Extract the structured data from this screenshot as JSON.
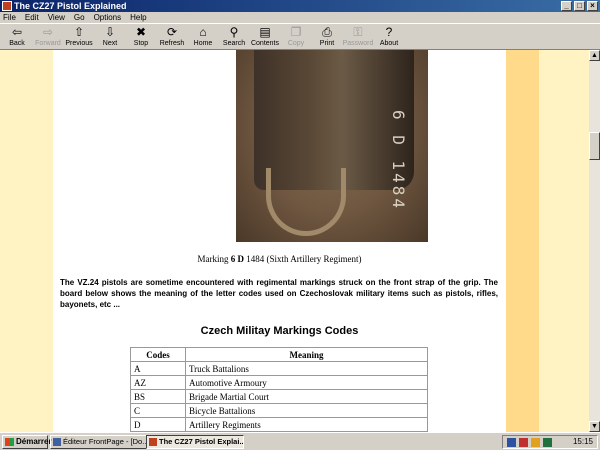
{
  "window": {
    "title": "The CZ27 Pistol Explained"
  },
  "menu": [
    "File",
    "Edit",
    "View",
    "Go",
    "Options",
    "Help"
  ],
  "toolbar": [
    {
      "label": "Back",
      "icon": "arrow-left-icon",
      "glyph": "⇦",
      "enabled": true
    },
    {
      "label": "Forward",
      "icon": "arrow-right-icon",
      "glyph": "⇨",
      "enabled": false
    },
    {
      "label": "Previous",
      "icon": "arrow-up-icon",
      "glyph": "⇧",
      "enabled": true
    },
    {
      "label": "Next",
      "icon": "arrow-down-icon",
      "glyph": "⇩",
      "enabled": true
    },
    {
      "label": "Stop",
      "icon": "stop-icon",
      "glyph": "✖",
      "enabled": true
    },
    {
      "label": "Refresh",
      "icon": "refresh-icon",
      "glyph": "⟳",
      "enabled": true
    },
    {
      "label": "Home",
      "icon": "home-icon",
      "glyph": "⌂",
      "enabled": true
    },
    {
      "label": "Search",
      "icon": "search-icon",
      "glyph": "⚲",
      "enabled": true
    },
    {
      "label": "Contents",
      "icon": "contents-icon",
      "glyph": "▤",
      "enabled": true
    },
    {
      "label": "Copy",
      "icon": "copy-icon",
      "glyph": "❐",
      "enabled": false
    },
    {
      "label": "Print",
      "icon": "print-icon",
      "glyph": "⎙",
      "enabled": true
    },
    {
      "label": "Password",
      "icon": "password-icon",
      "glyph": "⚿",
      "enabled": false
    },
    {
      "label": "About",
      "icon": "about-icon",
      "glyph": "?",
      "enabled": true
    }
  ],
  "page": {
    "photo_marking": "6 D 1484",
    "caption_prefix": "Marking ",
    "caption_bold": "6 D",
    "caption_suffix": " 1484 (Sixth Artillery Regiment)",
    "paragraph": "The VZ.24 pistols are sometime encountered with regimental markings struck on the front strap of the grip. The board below shows the meaning of the letter codes used on Czechoslovak military items such as pistols, rifles, bayonets, etc ...",
    "heading": "Czech Militay Markings Codes",
    "table": {
      "headers": [
        "Codes",
        "Meaning"
      ],
      "rows": [
        [
          "A",
          "Truck Battalions"
        ],
        [
          "AZ",
          "Automotive Armoury"
        ],
        [
          "BS",
          "Brigade Martial Court"
        ],
        [
          "C",
          "Bicycle Battalions"
        ],
        [
          "D",
          "Artillery Regiments"
        ]
      ]
    }
  },
  "colors": {
    "page_bg": "#fff3c4",
    "band": "#ffda8b",
    "titlebar": "#0a246a"
  },
  "taskbar": {
    "start": "Démarrer",
    "tasks": [
      {
        "label": "Éditeur FrontPage - [Do...",
        "active": false
      },
      {
        "label": "The CZ27 Pistol Explai...",
        "active": true
      }
    ],
    "clock": "15:15"
  }
}
